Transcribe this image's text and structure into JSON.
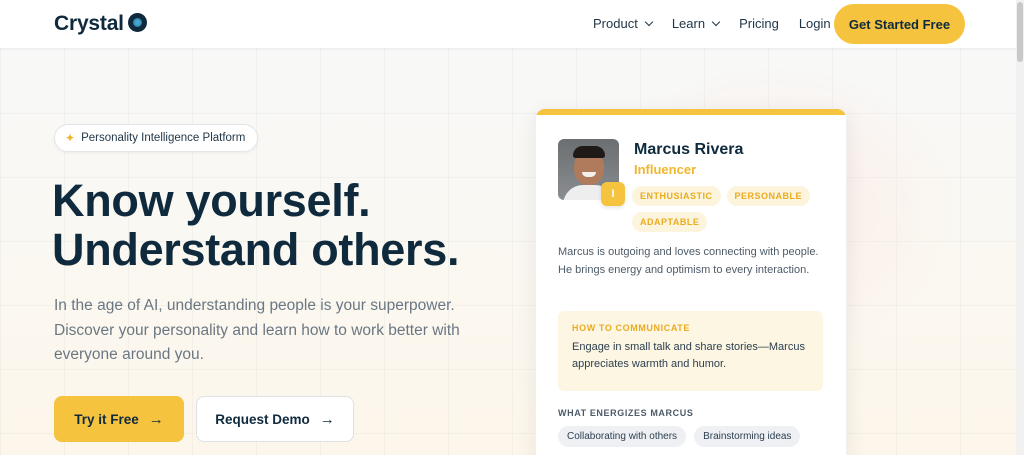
{
  "nav": {
    "logo_text": "Crystal",
    "items": [
      {
        "label": "Product",
        "has_dropdown": true
      },
      {
        "label": "Learn",
        "has_dropdown": true
      },
      {
        "label": "Pricing",
        "has_dropdown": false
      },
      {
        "label": "Login",
        "has_dropdown": false
      }
    ],
    "cta_label": "Get Started Free"
  },
  "hero": {
    "badge_label": "Personality Intelligence Platform",
    "headline_line1": "Know yourself.",
    "headline_line2": "Understand others.",
    "subtext": "In the age of AI, understanding people is your superpower. Discover your personality and learn how to work better with everyone around you.",
    "primary_button": "Try it Free",
    "secondary_button": "Request Demo"
  },
  "card": {
    "name": "Marcus Rivera",
    "type": "Influencer",
    "type_badge": "I",
    "tags": [
      "ENTHUSIASTIC",
      "PERSONABLE",
      "ADAPTABLE"
    ],
    "description": "Marcus is outgoing and loves connecting with people. He brings energy and optimism to every interaction.",
    "communicate_title": "HOW TO COMMUNICATE",
    "communicate_text": "Engage in small talk and share stories—Marcus appreciates warmth and humor.",
    "energizes_title": "WHAT ENERGIZES MARCUS",
    "energizes": [
      "Collaborating with others",
      "Brainstorming ideas"
    ]
  },
  "colors": {
    "accent": "#f6c33f",
    "navy": "#0f2a3d",
    "muted_text": "#6a7783"
  }
}
